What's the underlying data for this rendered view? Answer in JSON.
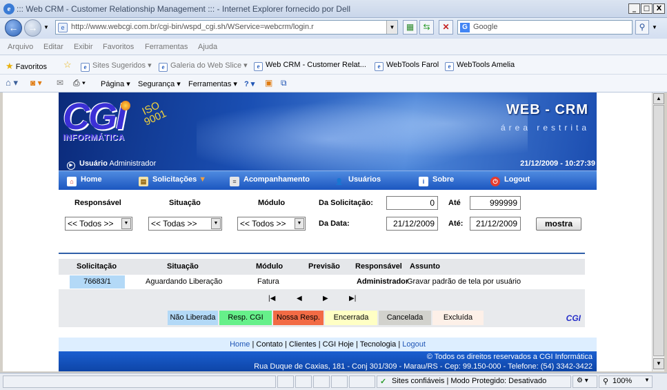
{
  "window": {
    "title": "::: Web CRM - Customer Relationship Management ::: - Internet Explorer fornecido por Dell",
    "controls": [
      "_",
      "□",
      "X"
    ]
  },
  "address_bar": {
    "url": "http://www.webcgi.com.br/cgi-bin/wspd_cgi.sh/WService=webcrm/login.r",
    "search_placeholder": "Google"
  },
  "menu": [
    "Arquivo",
    "Editar",
    "Exibir",
    "Favoritos",
    "Ferramentas",
    "Ajuda"
  ],
  "favorites_bar": {
    "favorites_label": "Favoritos",
    "items": [
      "Sites Sugeridos ▾",
      "Galeria do Web Slice ▾",
      "Web CRM - Customer Relat...",
      "WebTools Farol",
      "WebTools Amelia"
    ]
  },
  "command_bar": {
    "page": "Página ▾",
    "security": "Segurança ▾",
    "tools": "Ferramentas ▾"
  },
  "banner": {
    "logo": "CGI",
    "logo_sub": "INFORMÁTICA",
    "iso": "ISO 9001",
    "app": "WEB - CRM",
    "subtitle": "área restrita",
    "user_label": "Usuário",
    "user_name": "Administrador",
    "datetime": "21/12/2009 - 10:27:39"
  },
  "nav": [
    "Home",
    "Solicitações",
    "Acompanhamento",
    "Usuários",
    "Sobre",
    "Logout"
  ],
  "filters": {
    "responsavel_label": "Responsável",
    "responsavel_value": "<< Todos >>",
    "situacao_label": "Situação",
    "situacao_value": "<< Todas >>",
    "modulo_label": "Módulo",
    "modulo_value": "<< Todos >>",
    "da_solicitacao_label": "Da Solicitação:",
    "da_solicitacao_value": "0",
    "ate1_label": "Até",
    "ate1_value": "999999",
    "da_data_label": "Da Data:",
    "da_data_value": "21/12/2009",
    "ate2_label": "Até:",
    "ate2_value": "21/12/2009",
    "button": "mostra"
  },
  "table": {
    "headers": [
      "Solicitação",
      "Situação",
      "Módulo",
      "Previsão",
      "Responsável",
      "Assunto"
    ],
    "rows": [
      {
        "solicitacao": "76683/1",
        "situacao": "Aguardando Liberação",
        "modulo": "Fatura",
        "previsao": "",
        "responsavel": "Administrador",
        "assunto": "Gravar padrão de tela por usuário"
      }
    ]
  },
  "pager": [
    "|◀",
    "◀",
    "▶",
    "▶|"
  ],
  "legend": [
    {
      "label": "Não Liberada",
      "color": "#b3d9f7"
    },
    {
      "label": "Resp. CGI",
      "color": "#66f08a"
    },
    {
      "label": "Nossa Resp.",
      "color": "#f26b45"
    },
    {
      "label": "Encerrada",
      "color": "#ffffc4"
    },
    {
      "label": "Cancelada",
      "color": "#d2d2cd"
    },
    {
      "label": "Excluída",
      "color": "#fdf0e8"
    }
  ],
  "legend_logo": "CGI",
  "footer_nav": [
    "Home",
    "Contato",
    "Clientes",
    "CGI Hoje",
    "Tecnologia",
    "Logout"
  ],
  "footer": {
    "copyright": "© Todos os direitos reservados a CGI Informática",
    "address": "Rua Duque de Caxias, 181 - Conj 301/309 - Marau/RS - Cep: 99.150-000 - Telefone: (54) 3342-3422"
  },
  "status_bar": {
    "zone": "Sites confiáveis | Modo Protegido: Desativado",
    "zoom": "100%"
  }
}
